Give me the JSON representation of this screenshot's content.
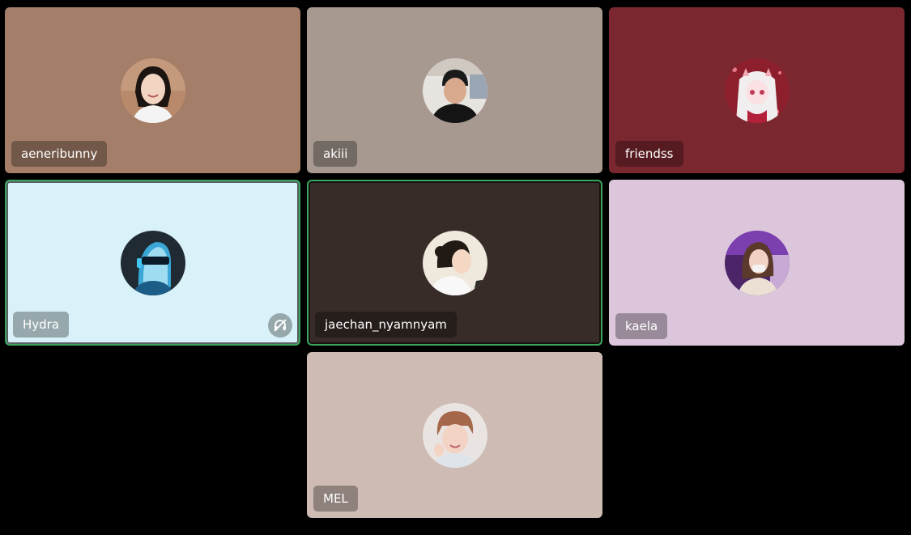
{
  "participants": [
    {
      "name": "aeneribunny",
      "tile_color": "#a47e68",
      "speaking": false,
      "muted": false,
      "avatar_icon": "person-photo-icon"
    },
    {
      "name": "akiii",
      "tile_color": "#a79990",
      "speaking": false,
      "muted": false,
      "avatar_icon": "person-photo-icon"
    },
    {
      "name": "friendss",
      "tile_color": "#7a272f",
      "speaking": false,
      "muted": false,
      "avatar_icon": "anime-girl-icon"
    },
    {
      "name": "Hydra",
      "tile_color": "#d9f1f8",
      "speaking": true,
      "muted": true,
      "avatar_icon": "robot-head-icon"
    },
    {
      "name": "jaechan_nyamnyam",
      "tile_color": "#372c28",
      "speaking": true,
      "muted": false,
      "avatar_icon": "person-photo-icon"
    },
    {
      "name": "kaela",
      "tile_color": "#dcc6dc",
      "speaking": false,
      "muted": false,
      "avatar_icon": "person-photo-icon"
    },
    {
      "name": "MEL",
      "tile_color": "#cdbbb4",
      "speaking": false,
      "muted": false,
      "avatar_icon": "person-photo-icon"
    }
  ],
  "icons": {
    "muted": "muted-headphones-icon"
  }
}
